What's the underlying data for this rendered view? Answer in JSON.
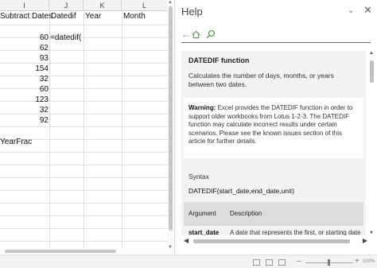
{
  "sheet": {
    "columns": [
      "I",
      "J",
      "K",
      "L"
    ],
    "header_row": {
      "subtract_dates": "Subtract Dates",
      "datedif": "Datedif",
      "year": "Year",
      "month": "Month"
    },
    "values": [
      "60",
      "62",
      "93",
      "154",
      "32",
      "60",
      "123",
      "32",
      "92"
    ],
    "active_formula": "=datedif(",
    "yearfrac_label": "YearFrac"
  },
  "help": {
    "title": "Help",
    "function_name": "DATEDIF function",
    "description": "Calculates the number of days, months, or years between two dates.",
    "warning_label": "Warning:",
    "warning_text": " Excel provides the DATEDIF function in order to support older workbooks from Lotus 1-2-3. The DATEDIF function may calculate incorrect results under certain scenarios. Please see the known issues section of this article for further details.",
    "syntax_label": "Syntax",
    "syntax": "DATEDIF(start_date,end_date,unit)",
    "table": {
      "col_argument": "Argument",
      "col_description": "Description",
      "row1_argument": "start_date",
      "row1_description": "A date that represents the first, or starting date"
    }
  },
  "statusbar": {
    "zoom_level": "100%"
  },
  "icons": {
    "back": "arrow-left-icon",
    "home": "home-icon",
    "search": "search-icon",
    "dropdown": "chevron-down-icon",
    "close": "close-icon"
  },
  "colors": {
    "accent": "#58a54a"
  }
}
